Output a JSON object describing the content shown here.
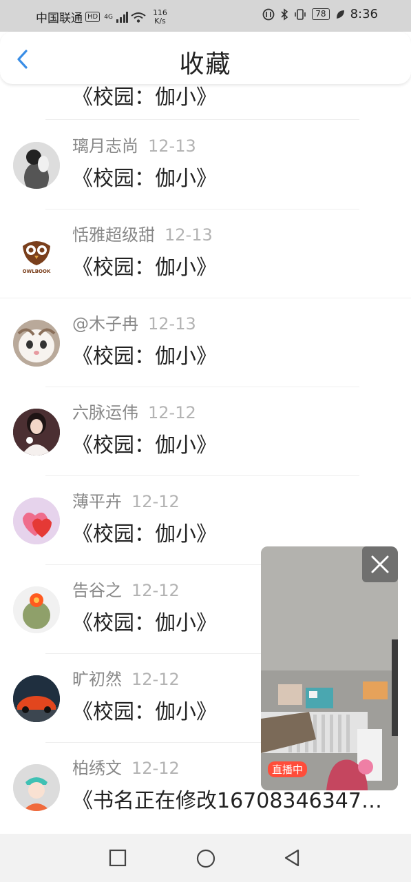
{
  "status_bar": {
    "carrier": "中国联通",
    "hd": "HD",
    "network": "4G",
    "speed": "116",
    "speed_unit": "K/s",
    "battery": "78",
    "time": "8:36"
  },
  "header": {
    "title": "收藏"
  },
  "items": [
    {
      "user": "",
      "date": "",
      "book": "《校园：伽小》"
    },
    {
      "user": "璃月志尚",
      "date": "12-13",
      "book": "《校园：伽小》"
    },
    {
      "user": "恬雅超级甜",
      "date": "12-13",
      "book": "《校园：伽小》"
    },
    {
      "user": "@木子冉",
      "date": "12-13",
      "book": "《校园：伽小》"
    },
    {
      "user": "六脉运伟",
      "date": "12-12",
      "book": "《校园：伽小》"
    },
    {
      "user": "薄平卉",
      "date": "12-12",
      "book": "《校园：伽小》"
    },
    {
      "user": "告谷之",
      "date": "12-12",
      "book": "《校园：伽小》"
    },
    {
      "user": "旷初然",
      "date": "12-12",
      "book": "《校园：伽小》"
    },
    {
      "user": "柏绣文",
      "date": "12-12",
      "book": "《书名正在修改16708346347…"
    }
  ],
  "owl_logo_text": "OWLBOOK",
  "floating_live": {
    "badge": "直播中"
  },
  "icons": [
    "back-arrow-icon",
    "close-icon",
    "square-nav-icon",
    "circle-nav-icon",
    "triangle-back-nav-icon"
  ]
}
